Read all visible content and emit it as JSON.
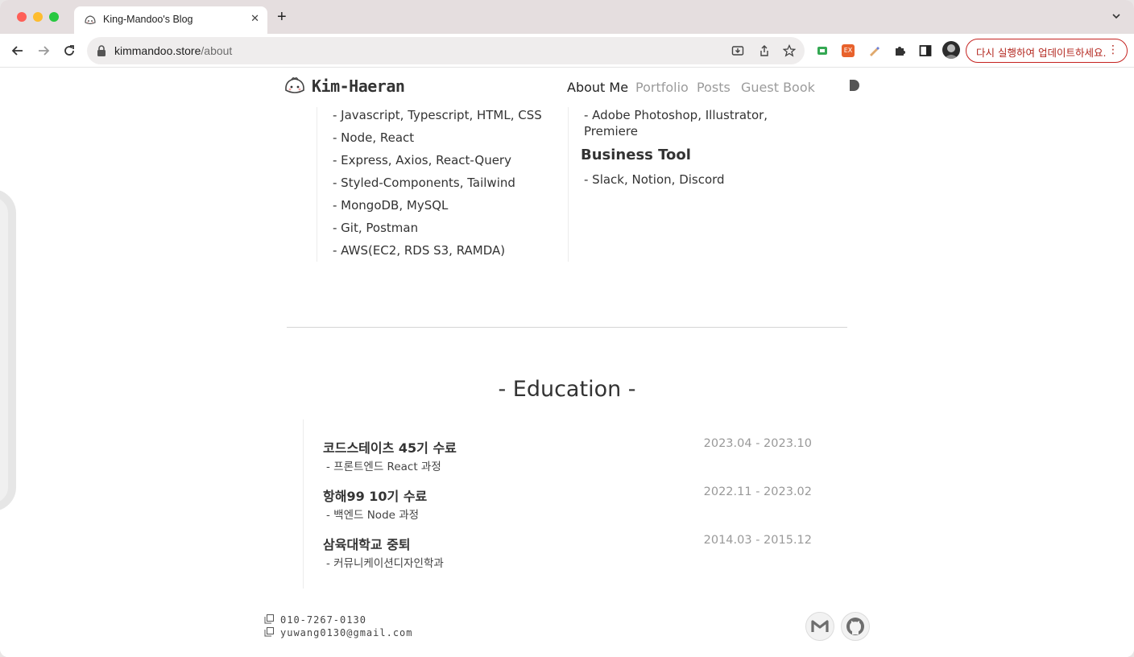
{
  "browser": {
    "tab_title": "King-Mandoo's Blog",
    "url_host": "kimmandoo.store",
    "url_path": "/about",
    "update_button": "다시 실행하여 업데이트하세요.",
    "ext_ex_label": "EX"
  },
  "header": {
    "logo_text": "Kim-Haeran",
    "nav": [
      "About Me",
      "Portfolio",
      "Posts",
      "Guest Book"
    ]
  },
  "skills_left": [
    "- Javascript, Typescript, HTML, CSS",
    "- Node, React",
    "- Express, Axios, React-Query",
    "- Styled-Components, Tailwind",
    "- MongoDB, MySQL",
    "- Git, Postman",
    "- AWS(EC2, RDS S3, RAMDA)"
  ],
  "skills_right": {
    "design_line1": "- Adobe Photoshop, Illustrator,",
    "design_line2": "Premiere",
    "business_title": "Business Tool",
    "business_items": "- Slack, Notion, Discord"
  },
  "education": {
    "title": "- Education -",
    "items": [
      {
        "name": "코드스테이츠 45기 수료",
        "desc": "- 프론트엔드 React 과정",
        "date": "2023.04 - 2023.10"
      },
      {
        "name": "항해99 10기 수료",
        "desc": "- 백엔드 Node 과정",
        "date": "2022.11 - 2023.02"
      },
      {
        "name": "삼육대학교 중퇴",
        "desc": "- 커뮤니케이션디자인학과",
        "date": "2014.03 - 2015.12"
      }
    ]
  },
  "footer": {
    "phone": "010-7267-0130",
    "email": "yuwang0130@gmail.com"
  }
}
